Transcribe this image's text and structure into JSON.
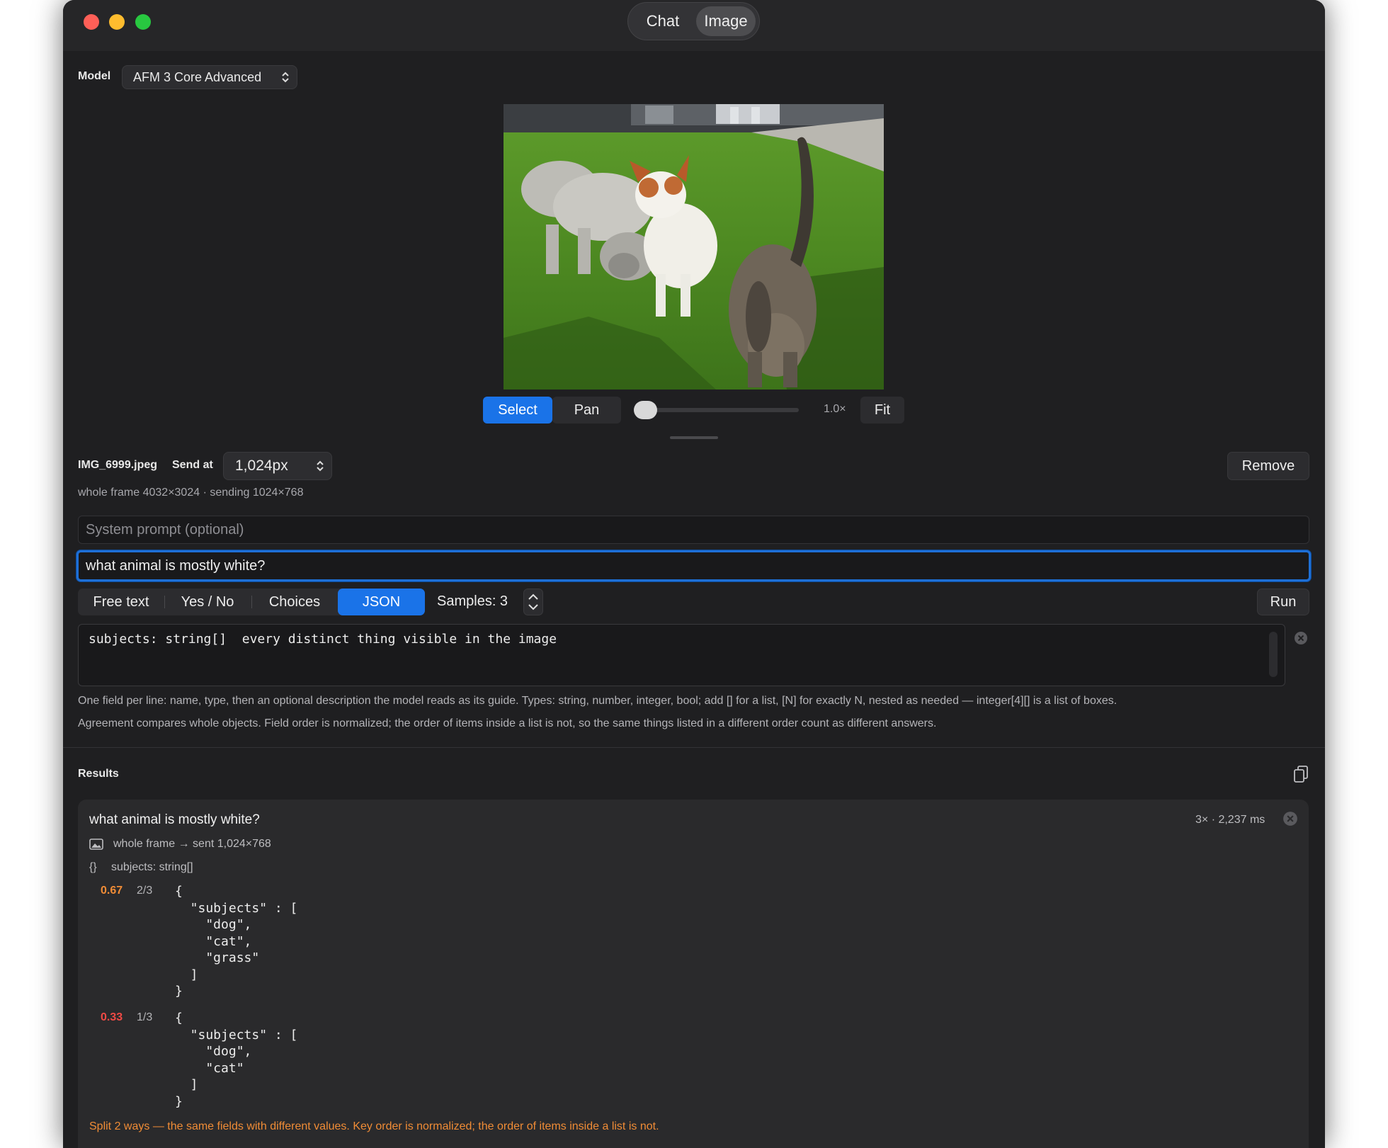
{
  "mode_switch": {
    "chat": "Chat",
    "image": "Image",
    "selected": "Image"
  },
  "model": {
    "label": "Model",
    "value": "AFM 3 Core Advanced"
  },
  "viewer": {
    "select": "Select",
    "pan": "Pan",
    "zoom": "1.0×",
    "zoom_level": 0.0,
    "fit": "Fit",
    "active_tool": "Select"
  },
  "file": {
    "name": "IMG_6999.jpeg",
    "send_at_label": "Send at",
    "send_at_value": "1,024px",
    "remove": "Remove",
    "info": "whole frame 4032×3024 · sending 1024×768"
  },
  "system_prompt": {
    "placeholder": "System prompt (optional)",
    "value": ""
  },
  "prompt": {
    "value": "what animal is mostly white?"
  },
  "format": {
    "options": [
      "Free text",
      "Yes / No",
      "Choices",
      "JSON"
    ],
    "selected": "JSON",
    "samples_label": "Samples: 3",
    "run": "Run"
  },
  "schema": {
    "text": "subjects: string[]  every distinct thing visible in the image",
    "help1": "One field per line: name, type, then an optional description the model reads as its guide. Types: string, number, integer, bool; add [] for a list, [N] for exactly N, nested as needed — integer[4][] is a list of boxes.",
    "help2": "Agreement compares whole objects. Field order is normalized; the order of items inside a list is not, so the same things listed in a different order count as different answers."
  },
  "results": {
    "title": "Results",
    "card": {
      "question": "what animal is mostly white?",
      "meta": "3× · 2,237 ms",
      "frame_line": "whole frame → sent 1,024×768",
      "schema_line": "subjects: string[]",
      "answers": [
        {
          "score": "0.67",
          "fraction": "2/3",
          "json": "{\n  \"subjects\" : [\n    \"dog\",\n    \"cat\",\n    \"grass\"\n  ]\n}"
        },
        {
          "score": "0.33",
          "fraction": "1/3",
          "json": "{\n  \"subjects\" : [\n    \"dog\",\n    \"cat\"\n  ]\n}"
        }
      ],
      "split_note": "Split 2 ways — the same fields with different values. Key order is normalized; the order of items inside a list is not."
    }
  },
  "icons": {
    "copy": "copy-icon",
    "close": "close-circle-icon",
    "image": "image-icon",
    "braces": "braces-icon",
    "stepper": "stepper-icon",
    "popup_chevrons": "up-down-chevron-icon"
  },
  "colors": {
    "accent": "#1a73e8",
    "warning": "#f08c36",
    "error": "#f04a45"
  }
}
